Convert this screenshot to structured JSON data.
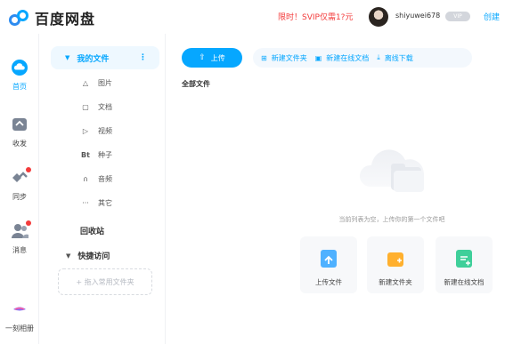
{
  "header": {
    "brand": "百度网盘",
    "promo": "限时！SVIP仅需1?元",
    "username": "shiyuwei678",
    "vip_badge": "VIP",
    "create_link": "创建"
  },
  "rail": {
    "items": [
      {
        "label": "首页",
        "icon": "cloud-home-icon",
        "active": true
      },
      {
        "label": "收发",
        "icon": "transfer-icon"
      },
      {
        "label": "同步",
        "icon": "sync-icon",
        "badge": true
      },
      {
        "label": "消息",
        "icon": "message-icon",
        "badge": true
      },
      {
        "label": "一刻相册",
        "icon": "album-icon"
      }
    ]
  },
  "sidebar": {
    "my_files": "我的文件",
    "more": "⋮",
    "categories": [
      {
        "label": "图片",
        "icon": "△"
      },
      {
        "label": "文档",
        "icon": "▢"
      },
      {
        "label": "视频",
        "icon": "▷"
      },
      {
        "label": "种子",
        "icon": "Bt"
      },
      {
        "label": "音频",
        "icon": "∩"
      },
      {
        "label": "其它",
        "icon": "···"
      }
    ],
    "recycle": "回收站",
    "quick_access": "快捷访问",
    "dropzone": "+ 拖入常用文件夹"
  },
  "toolbar": {
    "upload": "上传",
    "new_folder": "新建文件夹",
    "new_online_doc": "新建在线文档",
    "offline_download": "离线下载"
  },
  "main": {
    "breadcrumb": "全部文件",
    "empty_text": "当前列表为空，上传你的第一个文件吧",
    "cards": [
      {
        "label": "上传文件",
        "color": "#4fb1ff"
      },
      {
        "label": "新建文件夹",
        "color": "#ffb02e"
      },
      {
        "label": "新建在线文档",
        "color": "#3fcf9a"
      }
    ]
  },
  "colors": {
    "accent": "#06a7ff",
    "promo": "#f33b3b"
  }
}
